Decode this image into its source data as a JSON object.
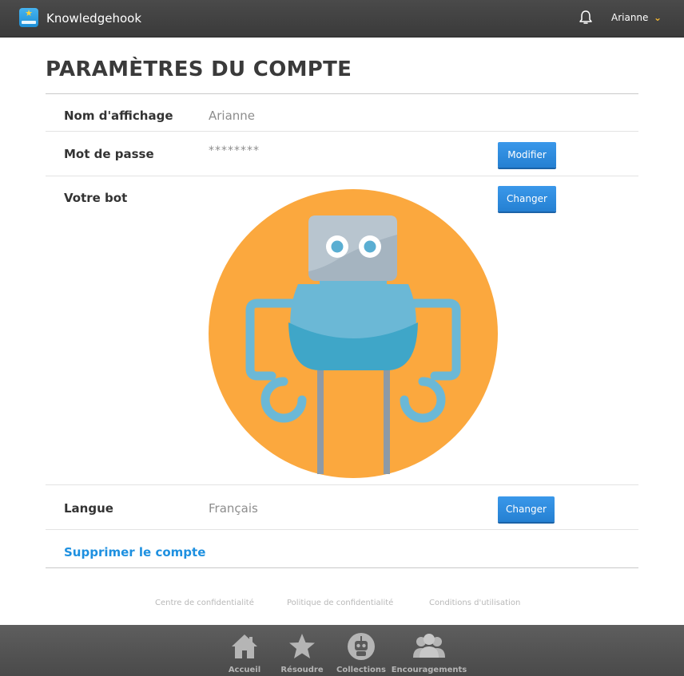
{
  "header": {
    "brand": "Knowledgehook",
    "user_name": "Arianne",
    "logo_icon": "star-book-icon",
    "notification_icon": "bell-icon"
  },
  "page": {
    "title": "PARAMÈTRES DU COMPTE"
  },
  "settings": {
    "display_name": {
      "label": "Nom d'affichage",
      "value": "Arianne"
    },
    "password": {
      "label": "Mot de passe",
      "value": "********",
      "button": "Modifier"
    },
    "bot": {
      "label": "Votre bot",
      "button": "Changer"
    },
    "language": {
      "label": "Langue",
      "value": "Français",
      "button": "Changer"
    },
    "delete_link": "Supprimer le compte"
  },
  "footer_links": [
    "Centre de confidentialité",
    "Politique de confidentialité",
    "Conditions d'utilisation"
  ],
  "bottom_nav": [
    {
      "label": "Accueil",
      "icon": "home-icon"
    },
    {
      "label": "Résoudre",
      "icon": "star-icon"
    },
    {
      "label": "Collections",
      "icon": "robot-icon"
    },
    {
      "label": "Encouragements",
      "icon": "people-icon"
    }
  ],
  "colors": {
    "accent": "#2a8ae0",
    "link": "#1e90e0",
    "bot_background": "#fba83e",
    "bot_body": "#6bb8d6",
    "bot_head": "#a5b4c0",
    "star": "#f4b733"
  }
}
